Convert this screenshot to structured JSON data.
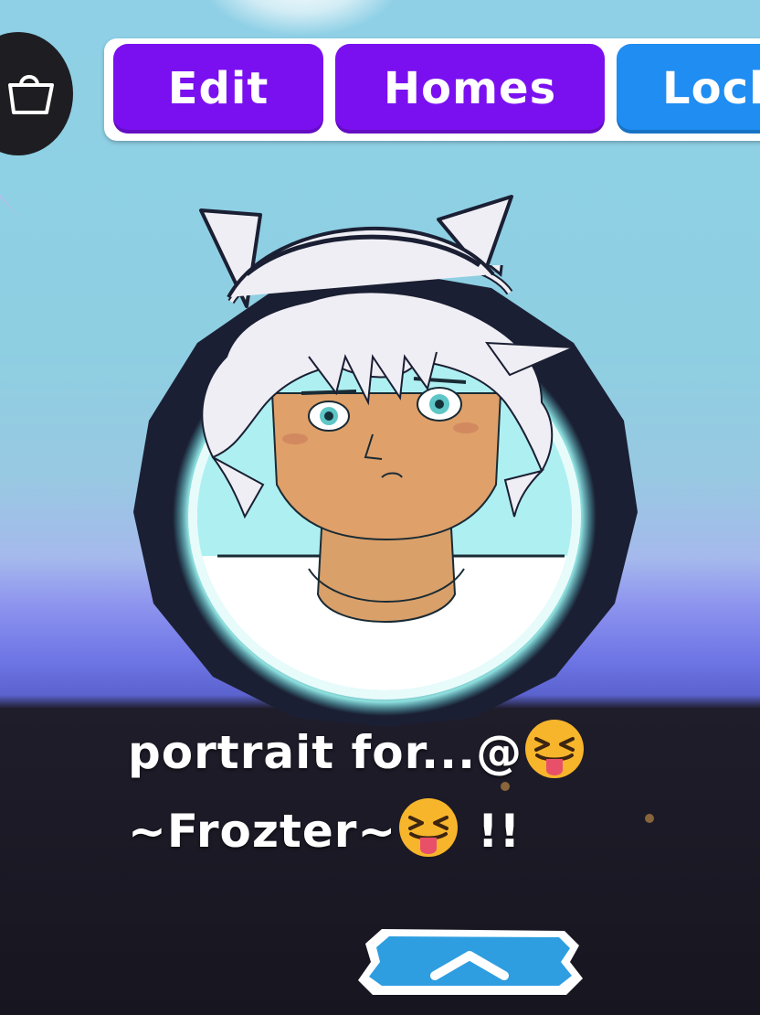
{
  "toolbar": {
    "shop_icon": "shopping-bag-icon",
    "tabs": [
      {
        "label": "Edit",
        "color": "#7a10f0"
      },
      {
        "label": "Homes",
        "color": "#7a10f0"
      },
      {
        "label": "Lock",
        "color": "#1f8df1"
      }
    ]
  },
  "caption": {
    "line1": "portrait for...@",
    "line2_prefix": "~Frozter~",
    "line2_suffix": " !!",
    "emoji": "squinting-face-with-tongue"
  },
  "bottom": {
    "expand_icon": "chevron-up-icon"
  }
}
